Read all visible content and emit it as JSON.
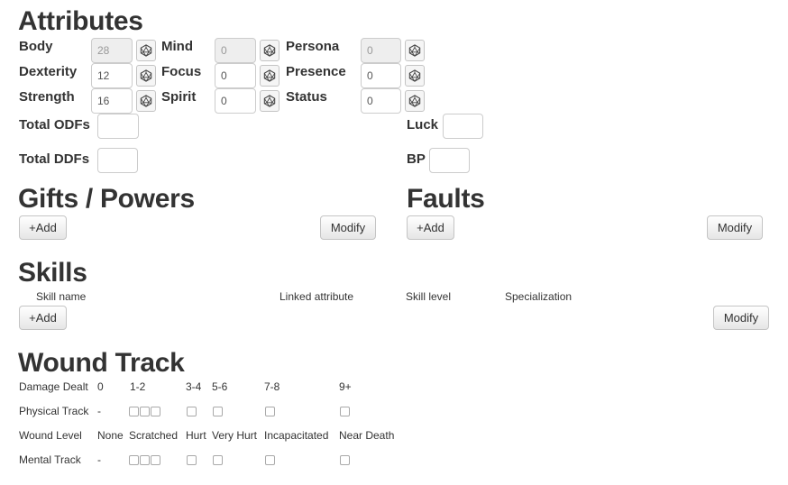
{
  "attributes": {
    "title": "Attributes",
    "body": {
      "label": "Body",
      "value": "28"
    },
    "dexterity": {
      "label": "Dexterity",
      "value": "12"
    },
    "strength": {
      "label": "Strength",
      "value": "16"
    },
    "mind": {
      "label": "Mind",
      "value": "0"
    },
    "focus": {
      "label": "Focus",
      "value": "0"
    },
    "spirit": {
      "label": "Spirit",
      "value": "0"
    },
    "persona": {
      "label": "Persona",
      "value": "0"
    },
    "presence": {
      "label": "Presence",
      "value": "0"
    },
    "status": {
      "label": "Status",
      "value": "0"
    },
    "total_odfs": {
      "label": "Total ODFs",
      "value": ""
    },
    "total_ddfs": {
      "label": "Total DDFs",
      "value": ""
    },
    "luck": {
      "label": "Luck",
      "value": ""
    },
    "bp": {
      "label": "BP",
      "value": ""
    }
  },
  "gifts": {
    "title": "Gifts / Powers",
    "add_label": "+Add",
    "modify_label": "Modify"
  },
  "faults": {
    "title": "Faults",
    "add_label": "+Add",
    "modify_label": "Modify"
  },
  "skills": {
    "title": "Skills",
    "columns": [
      "Skill name",
      "Linked attribute",
      "Skill level",
      "Specialization"
    ],
    "add_label": "+Add",
    "modify_label": "Modify"
  },
  "wound_track": {
    "title": "Wound Track",
    "damage_dealt": {
      "label": "Damage Dealt",
      "values": [
        "0",
        "1-2",
        "3-4",
        "5-6",
        "7-8",
        "9+"
      ]
    },
    "physical_track": {
      "label": "Physical Track",
      "dash": "-"
    },
    "wound_level": {
      "label": "Wound Level",
      "values": [
        "None",
        "Scratched",
        "Hurt",
        "Very Hurt",
        "Incapacitated",
        "Near Death"
      ]
    },
    "mental_track": {
      "label": "Mental Track",
      "dash": "-"
    }
  },
  "icons": {
    "dice": "dice-icon"
  }
}
